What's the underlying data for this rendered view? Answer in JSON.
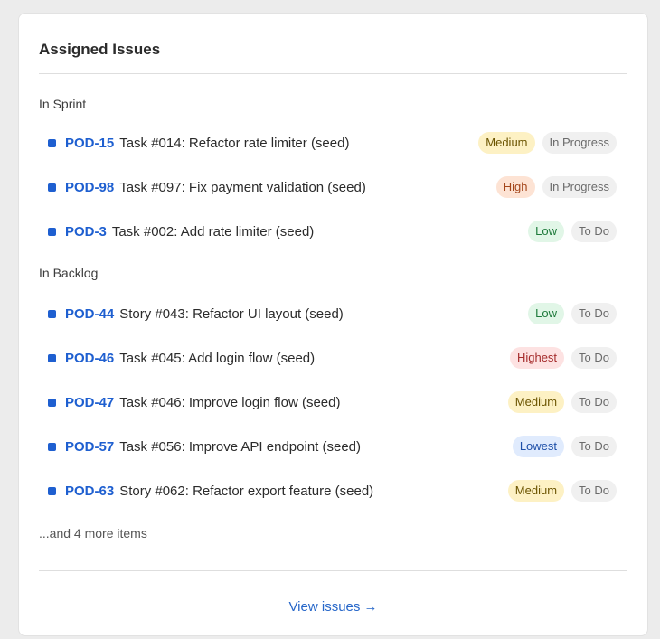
{
  "card": {
    "title": "Assigned Issues",
    "more_items": "...and 4 more items",
    "view_link": "View issues →"
  },
  "sections": [
    {
      "label": "In Sprint",
      "items": [
        {
          "key": "POD-15",
          "title": "Task #014: Refactor rate limiter (seed)",
          "priority": "Medium",
          "status": "In Progress"
        },
        {
          "key": "POD-98",
          "title": "Task #097: Fix payment validation (seed)",
          "priority": "High",
          "status": "In Progress"
        },
        {
          "key": "POD-3",
          "title": "Task #002: Add rate limiter (seed)",
          "priority": "Low",
          "status": "To Do"
        }
      ]
    },
    {
      "label": "In Backlog",
      "items": [
        {
          "key": "POD-44",
          "title": "Story #043: Refactor UI layout (seed)",
          "priority": "Low",
          "status": "To Do"
        },
        {
          "key": "POD-46",
          "title": "Task #045: Add login flow (seed)",
          "priority": "Highest",
          "status": "To Do"
        },
        {
          "key": "POD-47",
          "title": "Task #046: Improve login flow (seed)",
          "priority": "Medium",
          "status": "To Do"
        },
        {
          "key": "POD-57",
          "title": "Task #056: Improve API endpoint (seed)",
          "priority": "Lowest",
          "status": "To Do"
        },
        {
          "key": "POD-63",
          "title": "Story #062: Refactor export feature (seed)",
          "priority": "Medium",
          "status": "To Do"
        }
      ]
    }
  ],
  "colors": {
    "issue_key": "#1e5fd0",
    "link": "#2767c9",
    "priority_medium_bg": "#fdf1c4",
    "priority_high_bg": "#fde3d4",
    "priority_low_bg": "#e1f6e7",
    "priority_highest_bg": "#fde2e2",
    "priority_lowest_bg": "#e0ebfd",
    "status_bg": "#f0f0f0"
  },
  "icons": {
    "issue_bullet": "square-bullet-icon"
  }
}
